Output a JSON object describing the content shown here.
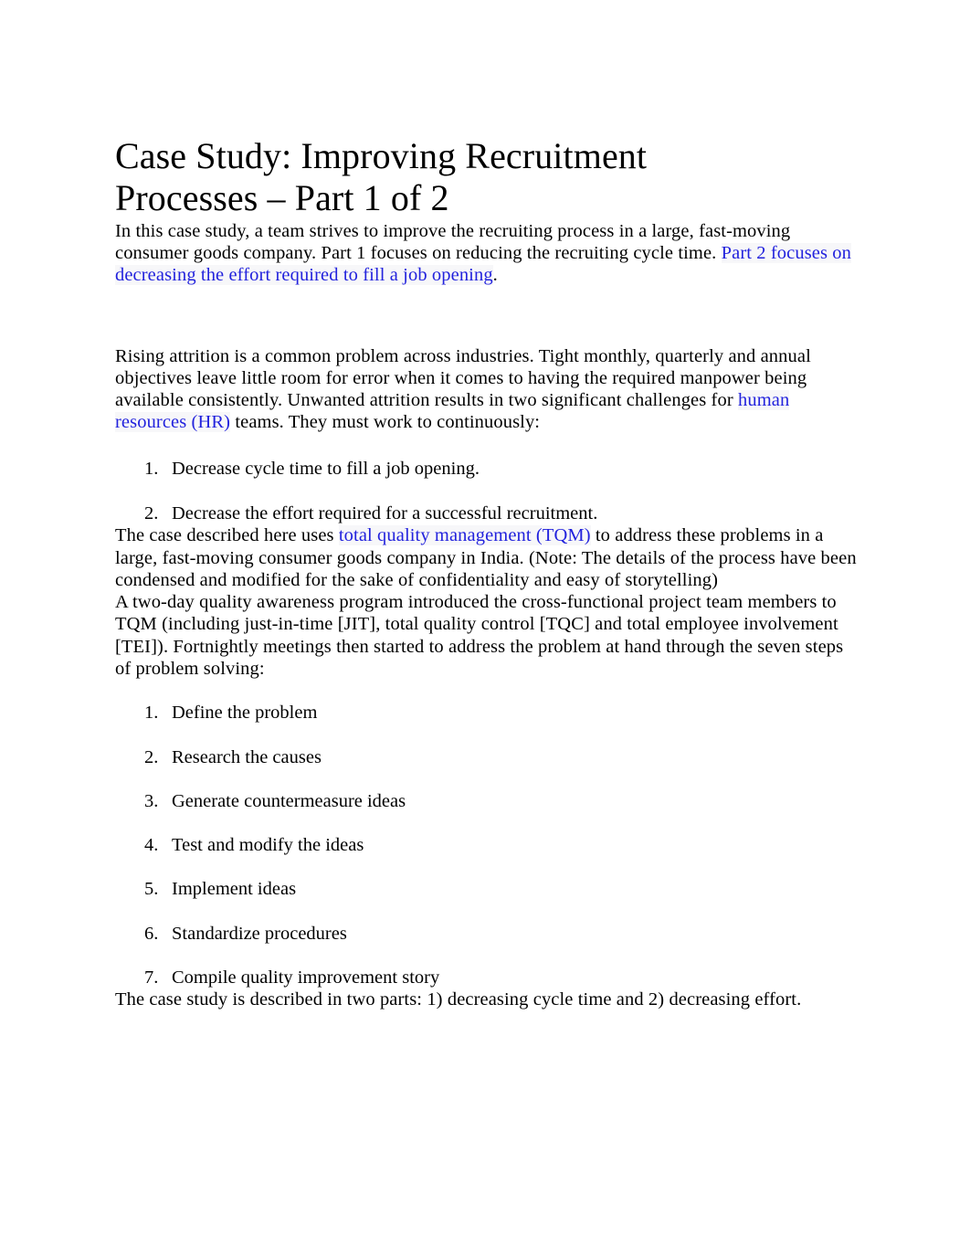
{
  "document": {
    "title": "Case Study: Improving Recruitment Processes – Part 1 of 2",
    "title_line_1": "Case Study: Improving Recruitment",
    "title_line_2": "Processes – Part 1 of 2",
    "link_color": "#2222dd",
    "text_color": "#000000",
    "background_color": "#ffffff",
    "highlight_color": "#f7f7f9"
  },
  "intro_paragraph": {
    "text_before_link": "In this case study, a team strives to improve the recruiting process in a large, fast-moving consumer goods company. Part 1 focuses on reducing the recruiting cycle time. ",
    "link_text": "Part 2 focuses on decreasing the effort required to fill a job opening",
    "text_after_link": "."
  },
  "attrition_paragraph": {
    "text_before_link": "Rising attrition is a common problem across industries. Tight monthly, quarterly and annual objectives leave little room for error when it comes to having the required manpower being available consistently. Unwanted attrition results in two significant challenges for ",
    "link_text": "human resources (HR)",
    "text_after_link": " teams. They must work to continuously:"
  },
  "challenges_list": [
    {
      "number": "1.",
      "label": "Decrease cycle time to fill a job opening."
    },
    {
      "number": "2.",
      "label": "Decrease the effort required for a successful recruitment."
    }
  ],
  "tqm_paragraph": {
    "text_before_link": "The case described here uses ",
    "link_text": "total quality management (TQM)",
    "text_after_link": " to address these problems in a large, fast-moving consumer goods company in India. (Note: The details of the process have been condensed and modified for the sake of confidentiality and easy of storytelling)"
  },
  "program_paragraph": {
    "text": "A two-day quality awareness program introduced the cross-functional project team members to TQM (including just-in-time [JIT], total quality control [TQC] and total employee involvement [TEI]). Fortnightly meetings then started to address the problem at hand through the seven steps of problem solving:"
  },
  "steps_list": [
    {
      "number": "1.",
      "label": "Define the problem"
    },
    {
      "number": "2.",
      "label": "Research the causes"
    },
    {
      "number": "3.",
      "label": "Generate countermeasure ideas"
    },
    {
      "number": "4.",
      "label": "Test and modify the ideas"
    },
    {
      "number": "5.",
      "label": "Implement ideas"
    },
    {
      "number": "6.",
      "label": "Standardize procedures"
    },
    {
      "number": "7.",
      "label": "Compile quality improvement story"
    }
  ],
  "closing_paragraph": {
    "text": "The case study is described in two parts: 1) decreasing cycle time and 2) decreasing effort."
  }
}
